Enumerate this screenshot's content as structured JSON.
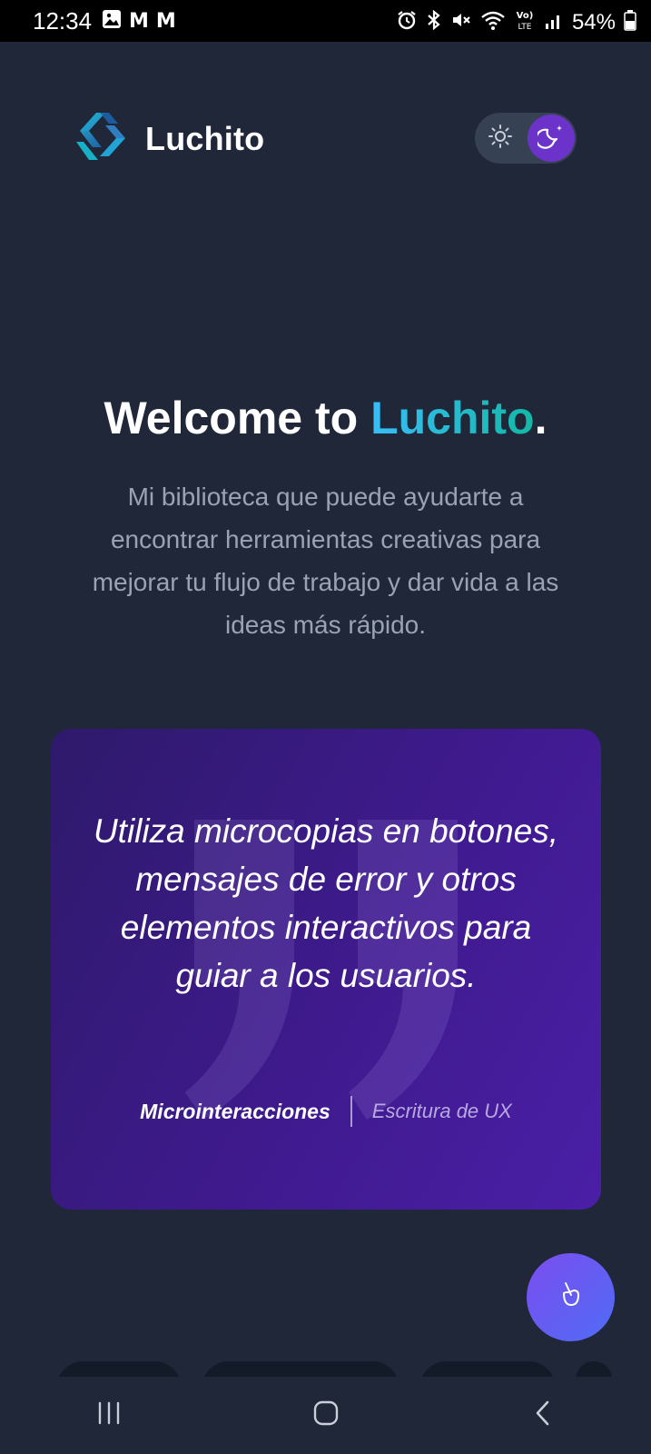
{
  "status_bar": {
    "time": "12:34",
    "notifications": [
      "gallery-icon",
      "gmail-icon",
      "gmail-icon"
    ],
    "gmail_letter": "M",
    "system_icons": [
      "alarm-icon",
      "bluetooth-icon",
      "mute-icon",
      "wifi-icon",
      "volte-icon",
      "signal-icon"
    ],
    "battery_text": "54%"
  },
  "header": {
    "brand_name": "Luchito",
    "theme": {
      "options": [
        "light",
        "dark"
      ],
      "selected": "dark",
      "selected_color": "#6b33c9"
    }
  },
  "hero": {
    "title_prefix": "Welcome to ",
    "title_accent": "Luchito",
    "title_suffix": ".",
    "subtitle": "Mi biblioteca que puede ayudarte a encontrar herramientas creativas para mejorar tu flujo de trabajo y dar vida a las ideas más rápido.",
    "accent_gradient": [
      "#38bdf8",
      "#14b8a6"
    ]
  },
  "quote_card": {
    "text": "Utiliza microcopias en botones, mensajes de error y otros elementos interactivos para guiar a los usuarios.",
    "tag_primary": "Microinteracciones",
    "tag_secondary": "Escritura de UX",
    "background": [
      "#2e1a6b",
      "#4a1fa6"
    ]
  },
  "fab": {
    "icon": "mate-icon",
    "gradient": [
      "#7c4df0",
      "#4f6cf5"
    ]
  },
  "nav_bar": {
    "buttons": [
      "recents-icon",
      "home-icon",
      "back-icon"
    ]
  },
  "colors": {
    "background": "#1f2739",
    "subtitle": "#9aa3b3"
  }
}
